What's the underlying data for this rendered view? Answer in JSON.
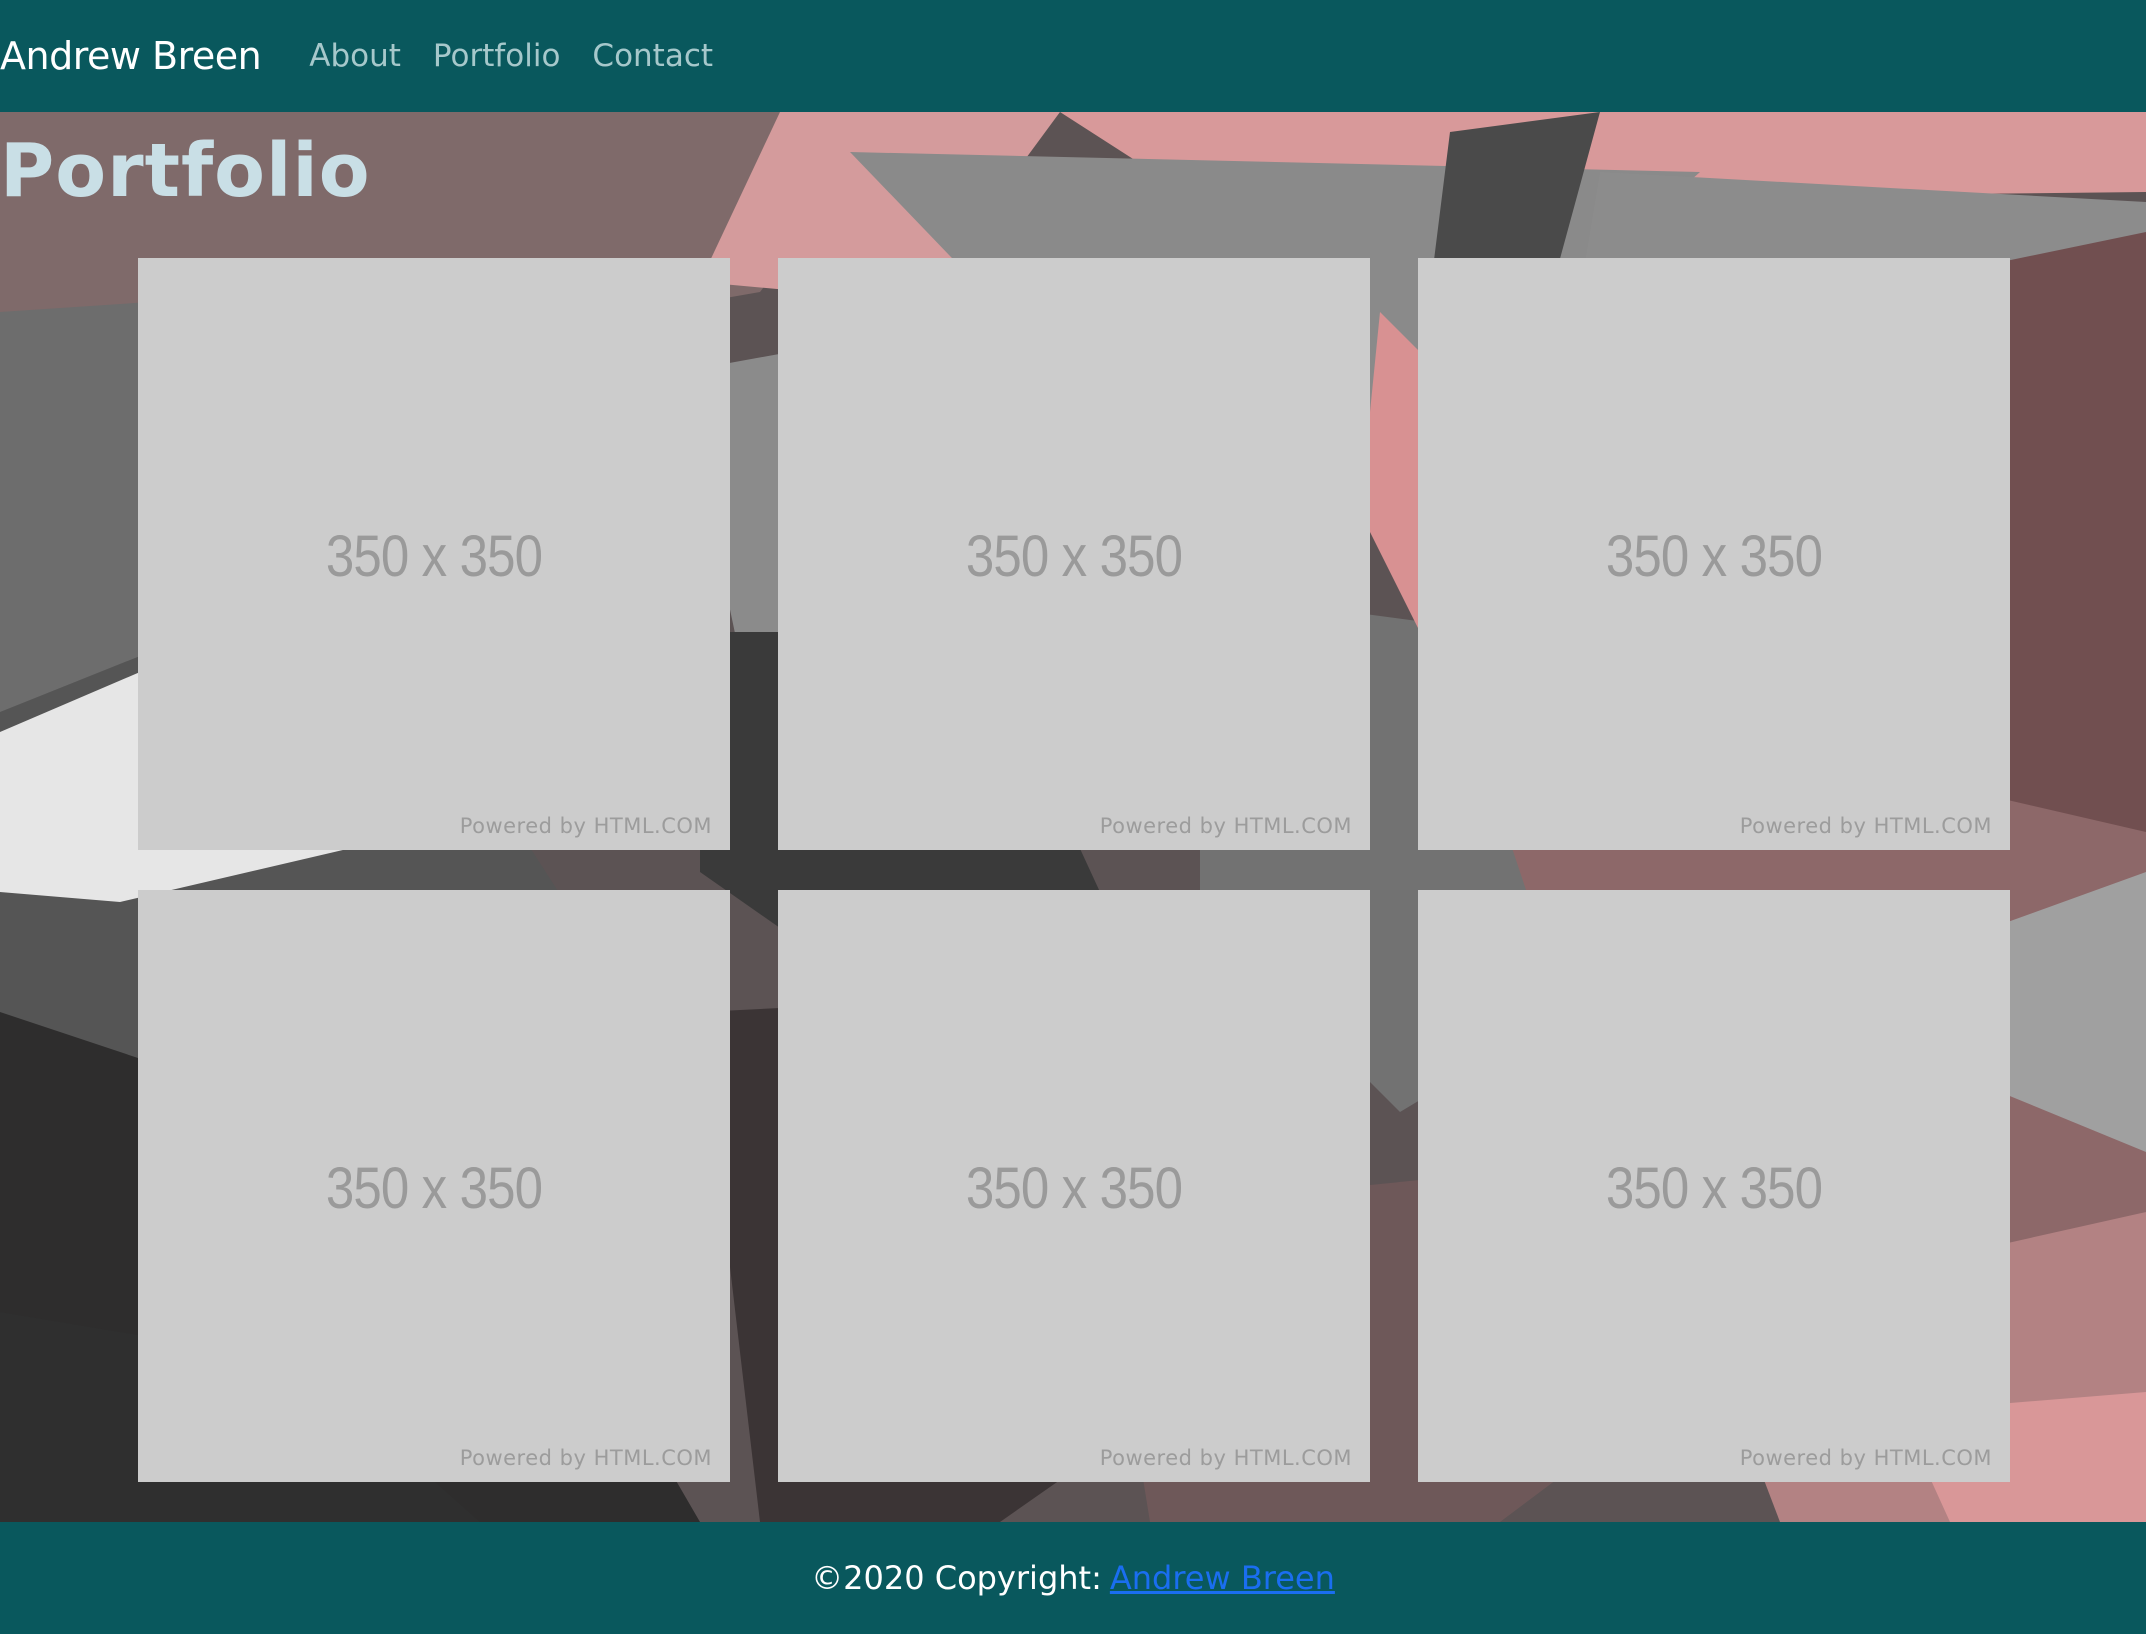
{
  "navbar": {
    "brand": "Andrew Breen",
    "links": [
      "About",
      "Portfolio",
      "Contact"
    ]
  },
  "main": {
    "title": "Portfolio",
    "cards": [
      {
        "dimensions": "350 x 350",
        "powered_by": "Powered by HTML.COM"
      },
      {
        "dimensions": "350 x 350",
        "powered_by": "Powered by HTML.COM"
      },
      {
        "dimensions": "350 x 350",
        "powered_by": "Powered by HTML.COM"
      },
      {
        "dimensions": "350 x 350",
        "powered_by": "Powered by HTML.COM"
      },
      {
        "dimensions": "350 x 350",
        "powered_by": "Powered by HTML.COM"
      },
      {
        "dimensions": "350 x 350",
        "powered_by": "Powered by HTML.COM"
      }
    ]
  },
  "footer": {
    "copyright": "©2020 Copyright:",
    "link": "Andrew Breen"
  },
  "colors": {
    "navbar_bg": "#09585d",
    "title_color": "#c9dfe6",
    "placeholder_bg": "#cccccc",
    "link_color": "#1a6ef0"
  }
}
